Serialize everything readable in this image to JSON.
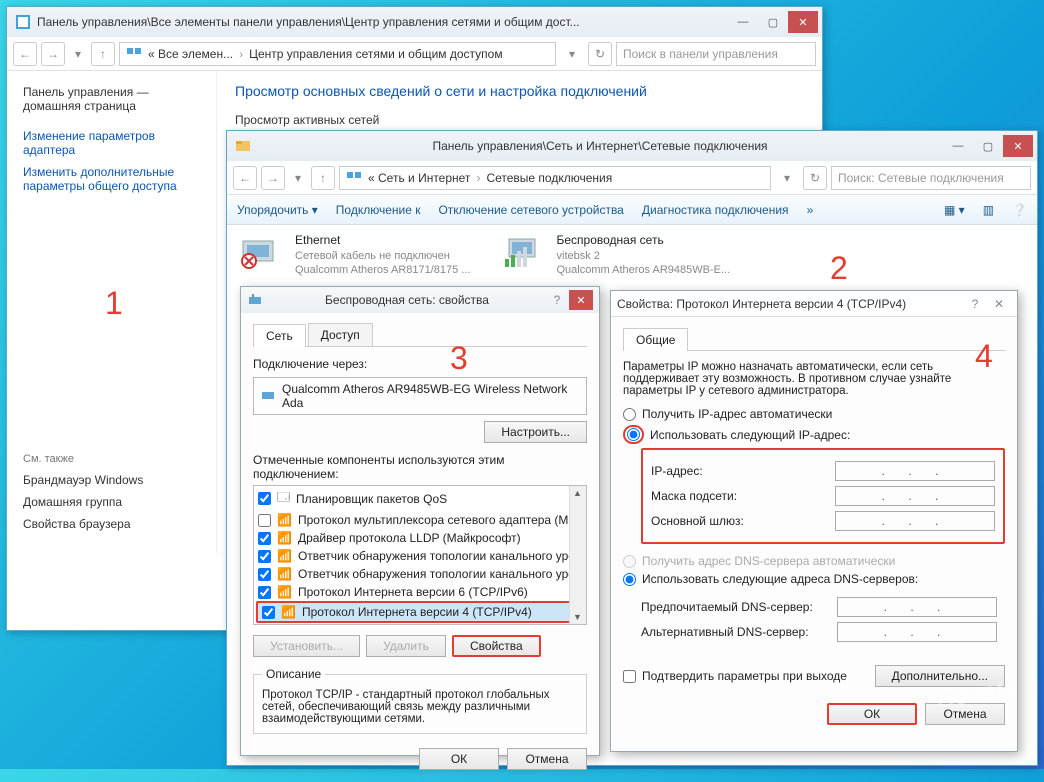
{
  "win1": {
    "title": "Панель управления\\Все элементы панели управления\\Центр управления сетями и общим дост...",
    "crumb1": "« Все элемен...",
    "crumb2": "Центр управления сетями и общим доступом",
    "search_ph": "Поиск в панели управления",
    "sidebar": {
      "home": "Панель управления — домашняя страница",
      "link1": "Изменение параметров адаптера",
      "link2": "Изменить дополнительные параметры общего доступа",
      "see": "См. также",
      "see1": "Брандмауэр Windows",
      "see2": "Домашняя группа",
      "see3": "Свойства браузера"
    },
    "main": {
      "h1": "Просмотр основных сведений о сети и настройка подключений",
      "sub": "Просмотр активных сетей"
    }
  },
  "win2": {
    "title": "Панель управления\\Сеть и Интернет\\Сетевые подключения",
    "crumb1": "« Сеть и Интернет",
    "crumb2": "Сетевые подключения",
    "search_ph": "Поиск: Сетевые подключения",
    "menu": {
      "m1": "Упорядочить",
      "m2": "Подключение к",
      "m3": "Отключение сетевого устройства",
      "m4": "Диагностика подключения"
    },
    "eth": {
      "t": "Ethernet",
      "s1": "Сетевой кабель не подключен",
      "s2": "Qualcomm Atheros AR8171/8175 ..."
    },
    "wifi": {
      "t": "Беспроводная сеть",
      "s1": "vitebsk  2",
      "s2": "Qualcomm Atheros AR9485WB-E..."
    }
  },
  "dlg3": {
    "title": "Беспроводная сеть: свойства",
    "tab1": "Сеть",
    "tab2": "Доступ",
    "conn_via": "Подключение через:",
    "adapter": "Qualcomm Atheros AR9485WB-EG Wireless Network Ada",
    "configure": "Настроить...",
    "components_hdr": "Отмеченные компоненты используются этим подключением:",
    "comp": [
      "Планировщик пакетов QoS",
      "Протокол мультиплексора сетевого адаптера (Май",
      "Драйвер протокола LLDP (Майкрософт)",
      "Ответчик обнаружения топологии канального уров",
      "Ответчик обнаружения топологии канального уров",
      "Протокол Интернета версии 6 (TCP/IPv6)",
      "Протокол Интернета версии 4 (TCP/IPv4)"
    ],
    "install": "Установить...",
    "remove": "Удалить",
    "props": "Свойства",
    "desc_hdr": "Описание",
    "desc": "Протокол TCP/IP - стандартный протокол глобальных сетей, обеспечивающий связь между различными взаимодействующими сетями.",
    "ok": "ОК",
    "cancel": "Отмена"
  },
  "dlg4": {
    "title": "Свойства: Протокол Интернета версии 4 (TCP/IPv4)",
    "tab": "Общие",
    "intro": "Параметры IP можно назначать автоматически, если сеть поддерживает эту возможность. В противном случае узнайте параметры IP у сетевого администратора.",
    "r1": "Получить IP-адрес автоматически",
    "r2": "Использовать следующий IP-адрес:",
    "ip_lbl": "IP-адрес:",
    "mask_lbl": "Маска подсети:",
    "gw_lbl": "Основной шлюз:",
    "r3": "Получить адрес DNS-сервера автоматически",
    "r4": "Использовать следующие адреса DNS-серверов:",
    "dns1_lbl": "Предпочитаемый DNS-сервер:",
    "dns2_lbl": "Альтернативный DNS-сервер:",
    "validate": "Подтвердить параметры при выходе",
    "adv": "Дополнительно...",
    "ok": "ОК",
    "cancel": "Отмена"
  },
  "nums": {
    "n1": "1",
    "n2": "2",
    "n3": "3",
    "n4": "4"
  }
}
